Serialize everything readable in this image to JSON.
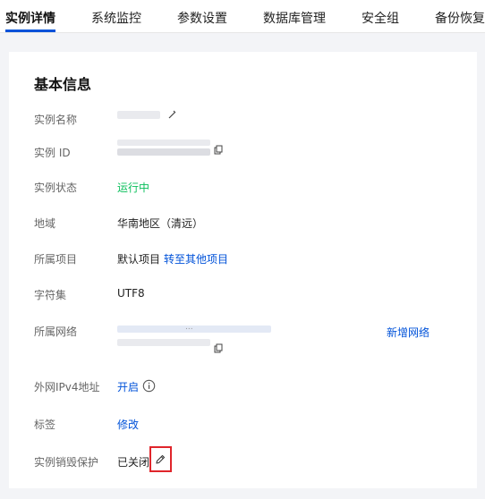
{
  "tabs": [
    {
      "label": "实例详情",
      "active": true
    },
    {
      "label": "系统监控"
    },
    {
      "label": "参数设置"
    },
    {
      "label": "数据库管理"
    },
    {
      "label": "安全组"
    },
    {
      "label": "备份恢复"
    }
  ],
  "card": {
    "title": "基本信息",
    "rows": {
      "instance_name": {
        "label": "实例名称"
      },
      "instance_id": {
        "label": "实例 ID"
      },
      "status": {
        "label": "实例状态",
        "value": "运行中"
      },
      "region": {
        "label": "地域",
        "value": "华南地区（清远）"
      },
      "project": {
        "label": "所属项目",
        "value": "默认项目",
        "action": "转至其他项目"
      },
      "charset": {
        "label": "字符集",
        "value": "UTF8"
      },
      "network": {
        "label": "所属网络",
        "action": "新增网络",
        "partial_text": "..."
      },
      "public_ip": {
        "label": "外网IPv4地址",
        "value": "开启"
      },
      "tags": {
        "label": "标签",
        "value": "修改"
      },
      "destroy_protect": {
        "label": "实例销毁保护",
        "value": "已关闭"
      }
    }
  },
  "colors": {
    "accent": "#0052d9",
    "running": "#0abf5b",
    "highlight": "#e0252b"
  }
}
